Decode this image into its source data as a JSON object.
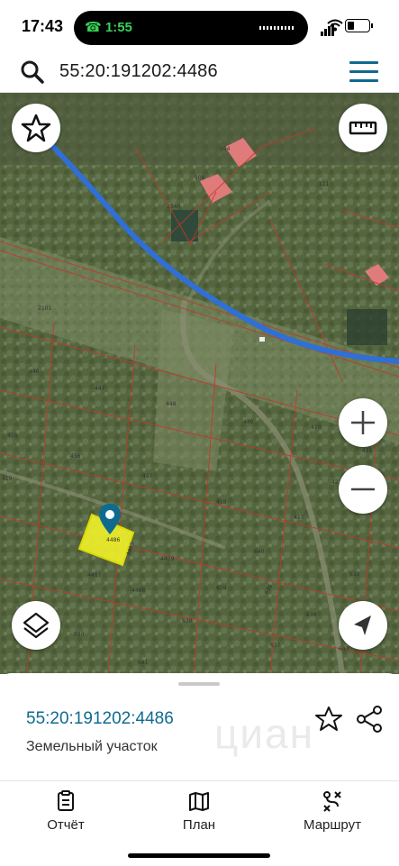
{
  "status_bar": {
    "time": "17:43",
    "call_timer": "1:55"
  },
  "search": {
    "query": "55:20:191202:4486"
  },
  "map": {
    "parcel_labels": [
      "104",
      "108",
      "111",
      "2540",
      "2101",
      "446",
      "447",
      "448",
      "449",
      "410",
      "415",
      "455",
      "456",
      "457",
      "458",
      "417",
      "419",
      "421",
      "4487",
      "4489",
      "4488",
      "4490",
      "4486",
      "640",
      "633",
      "639",
      "638",
      "637",
      "659",
      "670",
      "681",
      "590",
      "643"
    ],
    "colors": {
      "route": "#2f6fd6",
      "boundary": "#c0392b",
      "selected_parcel": "#f2f22a",
      "pin": "#0f6a8f"
    }
  },
  "bottom_sheet": {
    "parcel_id": "55:20:191202:4486",
    "parcel_type": "Земельный участок",
    "watermark": "циан"
  },
  "tabs": [
    {
      "label": "Отчёт",
      "icon": "report-icon"
    },
    {
      "label": "План",
      "icon": "map-plan-icon"
    },
    {
      "label": "Маршрут",
      "icon": "route-icon"
    }
  ]
}
